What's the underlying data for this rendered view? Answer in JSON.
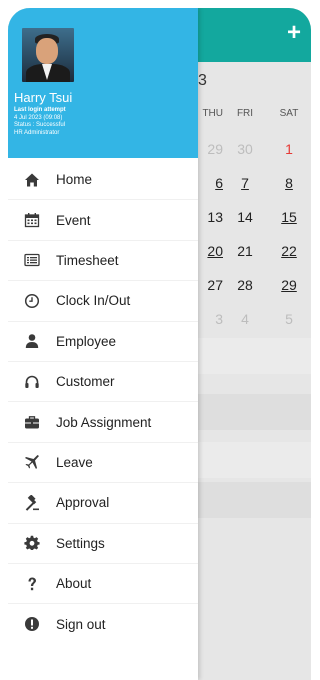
{
  "background": {
    "month_fragment": "3",
    "calendar_headers": [
      "THU",
      "FRI",
      "SAT"
    ],
    "calendar_rows": [
      [
        {
          "t": "29",
          "s": "muted"
        },
        {
          "t": "30",
          "s": "muted"
        },
        {
          "t": "1",
          "s": "red"
        }
      ],
      [
        {
          "t": "6",
          "s": "u"
        },
        {
          "t": "7",
          "s": "u"
        },
        {
          "t": "8",
          "s": "u"
        }
      ],
      [
        {
          "t": "13",
          "s": ""
        },
        {
          "t": "14",
          "s": ""
        },
        {
          "t": "15",
          "s": "u"
        }
      ],
      [
        {
          "t": "20",
          "s": "u"
        },
        {
          "t": "21",
          "s": ""
        },
        {
          "t": "22",
          "s": "u"
        }
      ],
      [
        {
          "t": "27",
          "s": ""
        },
        {
          "t": "28",
          "s": ""
        },
        {
          "t": "29",
          "s": "u"
        }
      ],
      [
        {
          "t": "3",
          "s": "muted"
        },
        {
          "t": "4",
          "s": "muted"
        },
        {
          "t": "5",
          "s": "muted"
        }
      ]
    ],
    "plus_label": "+"
  },
  "drawer": {
    "user": {
      "name": "Harry Tsui",
      "last_login_label": "Last login attempt",
      "last_login_time": "4 Jul 2023 (09:08)",
      "status": "Status : Successful",
      "role": "HR Administrator"
    },
    "menu": [
      {
        "label": "Home",
        "icon": "home-icon"
      },
      {
        "label": "Event",
        "icon": "calendar-icon"
      },
      {
        "label": "Timesheet",
        "icon": "timesheet-icon"
      },
      {
        "label": "Clock In/Out",
        "icon": "clock-icon"
      },
      {
        "label": "Employee",
        "icon": "person-icon"
      },
      {
        "label": "Customer",
        "icon": "headset-icon"
      },
      {
        "label": "Job Assignment",
        "icon": "briefcase-icon"
      },
      {
        "label": "Leave",
        "icon": "airplane-icon"
      },
      {
        "label": "Approval",
        "icon": "gavel-icon"
      },
      {
        "label": "Settings",
        "icon": "gear-icon"
      },
      {
        "label": "About",
        "icon": "question-icon"
      },
      {
        "label": "Sign out",
        "icon": "alert-icon"
      }
    ]
  }
}
